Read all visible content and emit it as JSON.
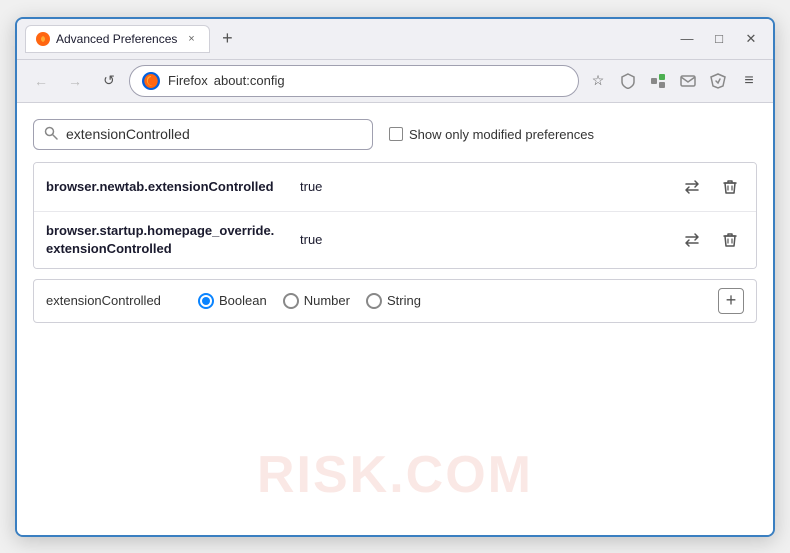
{
  "window": {
    "title": "Advanced Preferences",
    "controls": {
      "minimize": "—",
      "maximize": "□",
      "close": "✕"
    }
  },
  "tab": {
    "title": "Advanced Preferences",
    "close": "×"
  },
  "new_tab_btn": "+",
  "navbar": {
    "back": "←",
    "forward": "→",
    "reload": "↺",
    "browser_name": "Firefox",
    "address": "about:config",
    "bookmark_icon": "☆",
    "shield_icon": "🛡",
    "extension_icon": "🧩",
    "email_icon": "✉",
    "account_icon": "⟳",
    "menu_icon": "≡"
  },
  "search": {
    "placeholder": "extensionControlled",
    "value": "extensionControlled",
    "show_modified_label": "Show only modified preferences"
  },
  "preferences": [
    {
      "name": "browser.newtab.extensionControlled",
      "value": "true",
      "multiline": false
    },
    {
      "name_line1": "browser.startup.homepage_override.",
      "name_line2": "extensionControlled",
      "value": "true",
      "multiline": true
    }
  ],
  "new_preference": {
    "name": "extensionControlled",
    "type_options": [
      {
        "label": "Boolean",
        "selected": true
      },
      {
        "label": "Number",
        "selected": false
      },
      {
        "label": "String",
        "selected": false
      }
    ],
    "add_btn": "+"
  },
  "watermark": "RISK.COM",
  "icons": {
    "search": "🔍",
    "arrow_swap": "⇌",
    "trash": "🗑",
    "checkbox_empty": ""
  }
}
